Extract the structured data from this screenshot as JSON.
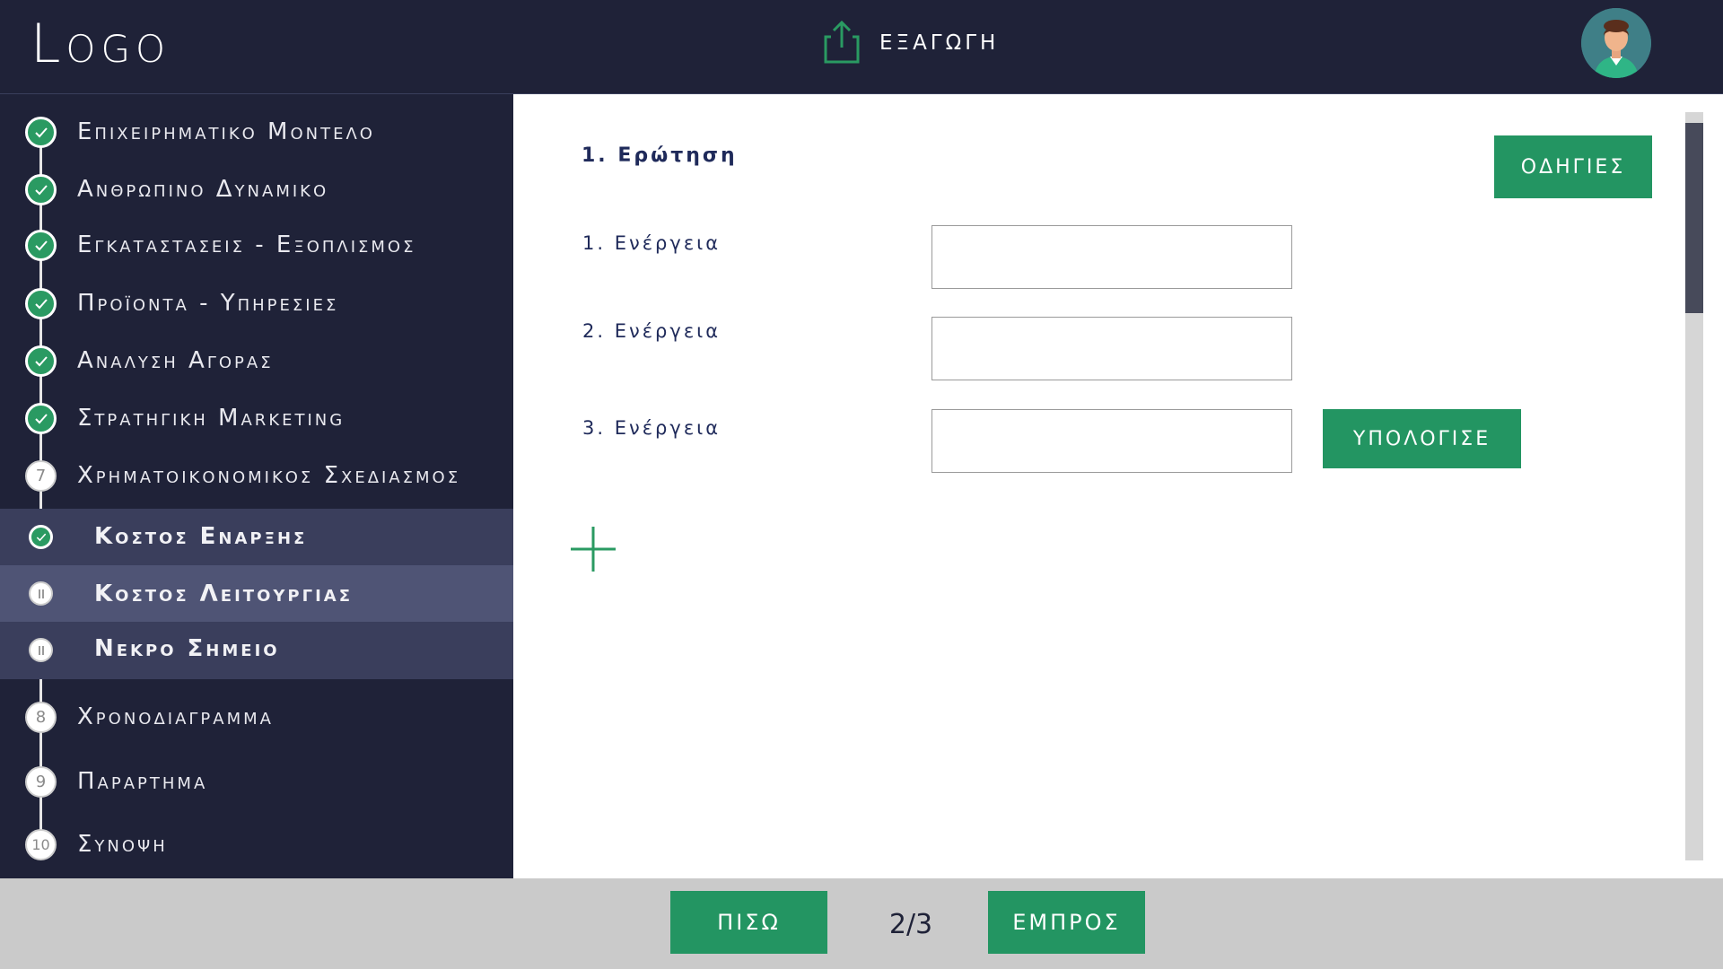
{
  "header": {
    "logo": "Logo",
    "export_label": "ΕΞΑΓΩΓΗ",
    "export_icon": "share-upload-icon",
    "avatar_icon": "user-avatar-icon"
  },
  "sidebar": {
    "items": [
      {
        "label": "Επιχειρηματικο Μοντελο",
        "status": "done"
      },
      {
        "label": "Ανθρωπινο Δυναμικο",
        "status": "done"
      },
      {
        "label": "Εγκαταστασεις - Εξοπλισμος",
        "status": "done"
      },
      {
        "label": "Προϊοντα - Υπηρεσιες",
        "status": "done"
      },
      {
        "label": "Αναλυση Αγορας",
        "status": "done"
      },
      {
        "label": "Στρατηγικη Marketing",
        "status": "done"
      },
      {
        "label": "Χρηματοικονομικος Σχεδιασμος",
        "number": "7"
      },
      {
        "label": "Κοστος Εναρξης",
        "status": "done"
      },
      {
        "label": "Κοστος Λειτουργιας",
        "status": "paused"
      },
      {
        "label": "Νεκρο Σημειο",
        "status": "paused"
      },
      {
        "label": "Χρονοδιαγραμμα",
        "number": "8"
      },
      {
        "label": "Παραρτημα",
        "number": "9"
      },
      {
        "label": "Συνοψη",
        "number": "10"
      }
    ]
  },
  "main": {
    "question_label": "1. Ερώτηση",
    "instructions_label": "ΟΔΗΓΙΕΣ",
    "actions": [
      {
        "label": "1. Ενέργεια",
        "value": ""
      },
      {
        "label": "2. Ενέργεια",
        "value": ""
      },
      {
        "label": "3. Ενέργεια",
        "value": ""
      }
    ],
    "calculate_label": "ΥΠΟΛΟΓΙΣΕ",
    "add_icon": "plus-icon"
  },
  "footer": {
    "back_label": "ΠΙΣΩ",
    "page_indicator": "2/3",
    "forward_label": "ΕΜΠΡΟΣ"
  },
  "colors": {
    "navy": "#1f2238",
    "green": "#239562",
    "sub_item": "#3a3e5c",
    "sub_item_active": "#4f5475",
    "footer": "#cacaca"
  }
}
